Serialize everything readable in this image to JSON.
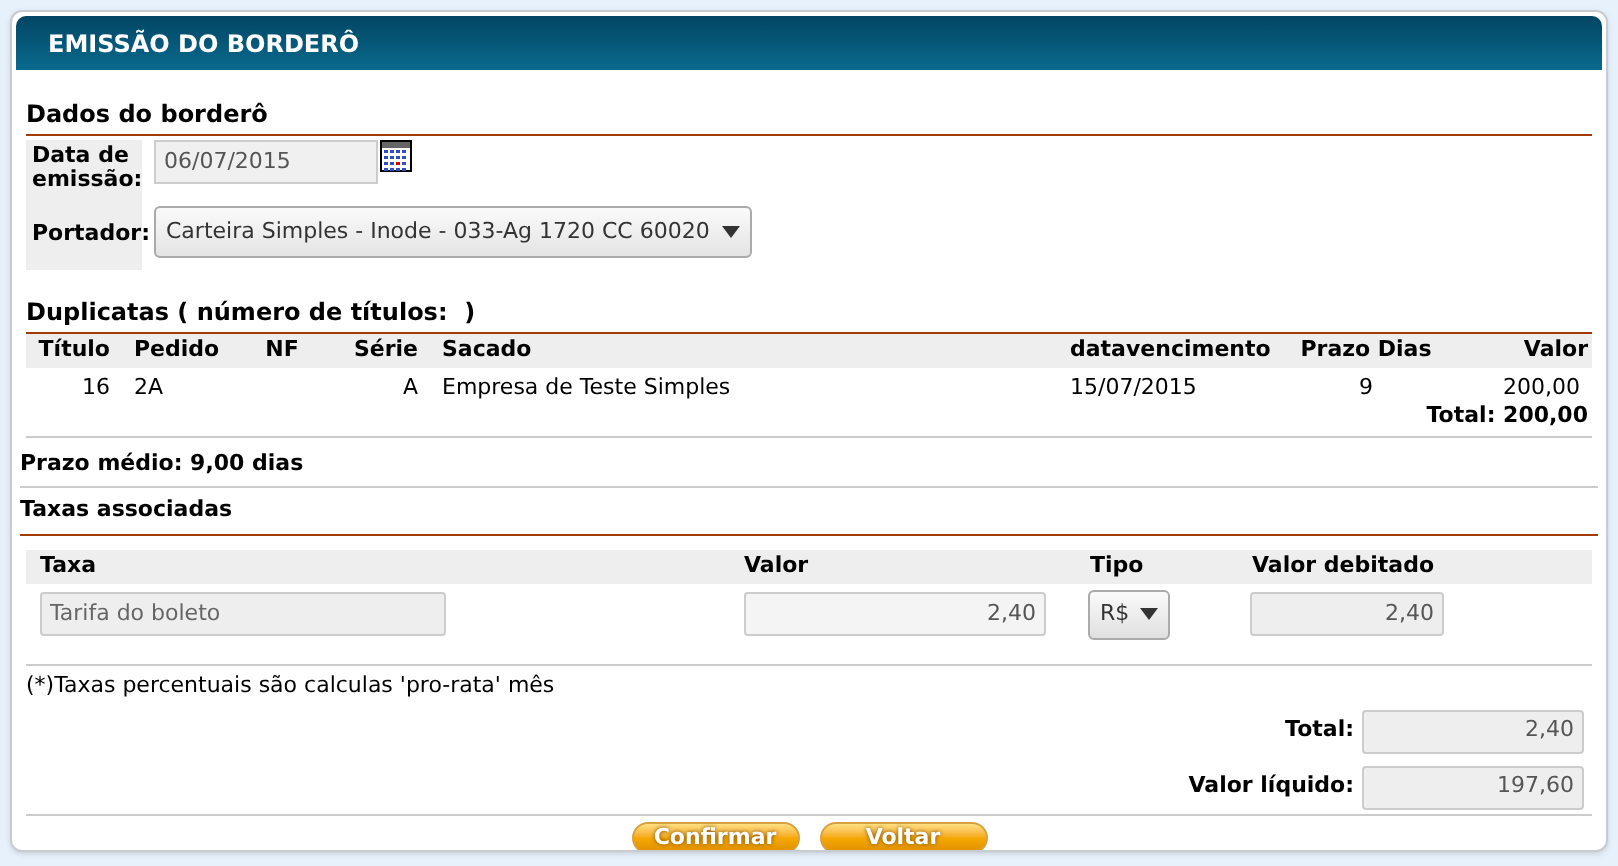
{
  "window": {
    "title": "EMISSÃO DO BORDERÔ"
  },
  "dados": {
    "title": "Dados do borderô",
    "data_label": "Data de emissão:",
    "data_value": "06/07/2015",
    "portador_label": "Portador:",
    "portador_value": "Carteira Simples - Inode - 033-Ag 1720 CC 60020"
  },
  "duplicatas": {
    "title": "Duplicatas ( número de títulos:  )",
    "columns": [
      "Título",
      "Pedido",
      "NF",
      "Série",
      "Sacado",
      "datavencimento",
      "Prazo Dias",
      "Valor"
    ],
    "rows": [
      [
        "16",
        "2A",
        "",
        "A",
        "Empresa de Teste Simples",
        "15/07/2015",
        "9",
        "200,00"
      ]
    ],
    "total": "Total: 200,00"
  },
  "prazo_medio": "Prazo médio: 9,00 dias",
  "taxas": {
    "title": "Taxas associadas",
    "columns": [
      "Taxa",
      "Valor",
      "Tipo",
      "Valor debitado"
    ],
    "rows": [
      {
        "taxa": "Tarifa do boleto",
        "valor": "2,40",
        "tipo": "R$",
        "debitado": "2,40"
      }
    ],
    "note": "(*)Taxas percentuais são calculas 'pro-rata' mês"
  },
  "totals": [
    {
      "label": "Total:",
      "value": "2,40"
    },
    {
      "label": "Valor líquido:",
      "value": "197,60"
    }
  ],
  "buttons": [
    "Confirmar",
    "Voltar"
  ]
}
